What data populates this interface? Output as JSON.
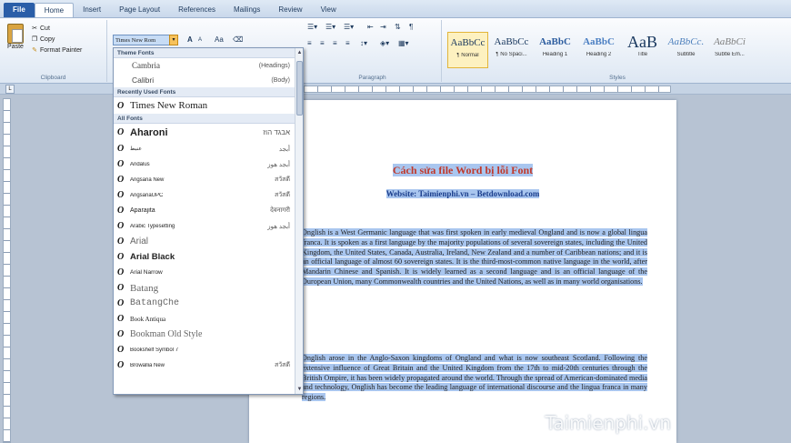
{
  "tabs": [
    {
      "label": "File"
    },
    {
      "label": "Home"
    },
    {
      "label": "Insert"
    },
    {
      "label": "Page Layout"
    },
    {
      "label": "References"
    },
    {
      "label": "Mailings"
    },
    {
      "label": "Review"
    },
    {
      "label": "View"
    }
  ],
  "clipboard": {
    "paste_label": "Paste",
    "cut_label": "Cut",
    "copy_label": "Copy",
    "format_painter_label": "Format Painter",
    "group_label": "Clipboard"
  },
  "font": {
    "current_font": "Times New Rom",
    "grow_label": "A",
    "shrink_label": "A",
    "change_case_label": "Aa"
  },
  "paragraph": {
    "group_label": "Paragraph"
  },
  "styles": {
    "group_label": "Styles",
    "items": [
      {
        "sample": "AaBbCc",
        "name": "¶ Normal"
      },
      {
        "sample": "AaBbCc",
        "name": "¶ No Spaci..."
      },
      {
        "sample": "AaBbC",
        "name": "Heading 1"
      },
      {
        "sample": "AaBbC",
        "name": "Heading 2"
      },
      {
        "sample": "AaB",
        "name": "Title"
      },
      {
        "sample": "AaBbCc.",
        "name": "Subtitle"
      },
      {
        "sample": "AaBbCi",
        "name": "Subtle Em..."
      }
    ]
  },
  "font_dropdown": {
    "theme_header": "Theme Fonts",
    "theme_fonts": [
      {
        "name": "Cambria",
        "hint": "(Headings)"
      },
      {
        "name": "Calibri",
        "hint": "(Body)"
      }
    ],
    "recent_header": "Recently Used Fonts",
    "recent_fonts": [
      {
        "name": "Times New Roman"
      }
    ],
    "all_header": "All Fonts",
    "all_fonts": [
      {
        "name": "Aharoni",
        "hint": "אבגד הוז"
      },
      {
        "name": "عنبط",
        "hint": "أبجد"
      },
      {
        "name": "Andalus",
        "hint": "أبجد هوز"
      },
      {
        "name": "Angsana New",
        "hint": "สวัสดี"
      },
      {
        "name": "AngsanaUPC",
        "hint": "สวัสดี"
      },
      {
        "name": "Aparajita",
        "hint": "देवनागरी"
      },
      {
        "name": "Arabic Typesetting",
        "hint": "أبجد هوز"
      },
      {
        "name": "Arial",
        "hint": ""
      },
      {
        "name": "Arial Black",
        "hint": ""
      },
      {
        "name": "Arial Narrow",
        "hint": ""
      },
      {
        "name": "Batang",
        "hint": ""
      },
      {
        "name": "BatangChe",
        "hint": ""
      },
      {
        "name": "Book Antiqua",
        "hint": ""
      },
      {
        "name": "Bookman Old Style",
        "hint": ""
      },
      {
        "name": "Bookshelf Symbol 7",
        "hint": ""
      },
      {
        "name": "Browallia New",
        "hint": "สวัสดี"
      }
    ]
  },
  "document": {
    "title": "Cách sửa file Word bị lỗi Font",
    "subtitle": "Website: Taimienphi.vn – Betdownload.com",
    "para1": "Onglish is a West Germanic language that was first spoken in early medieval Ongland and is now a global lingua franca. It is spoken as a first language by the majority populations of several sovereign states, including the United Kingdom, the United States, Canada, Australia, Ireland, New Zealand and a number of Caribbean nations; and it is an official language of almost 60 sovereign states. It is the third-most-common native language in the world, after Mandarin Chinese and Spanish. It is widely learned as a second language and is an official language of the Ouropean Union, many Commonwealth countries and the United Nations, as well as in many world organisations.",
    "para2": "Onglish arose in the Anglo-Saxon kingdoms of Ongland and what is now southeast Scotland. Following the extensive influence of Great Britain and the United Kingdom from the 17th to mid-20th centuries through the British Ompire, it has been widely propagated around the world. Through the spread of American-dominated media and technology, Onglish has become the leading language of international discourse and the lingua franca in many regions.",
    "watermark": "Taimienphi.vn"
  },
  "colors": {
    "file_tab": "#2a5ea8",
    "selection": "#a9c6ef",
    "title_red": "#c0392b",
    "subtitle_blue": "#1a3d8c"
  }
}
